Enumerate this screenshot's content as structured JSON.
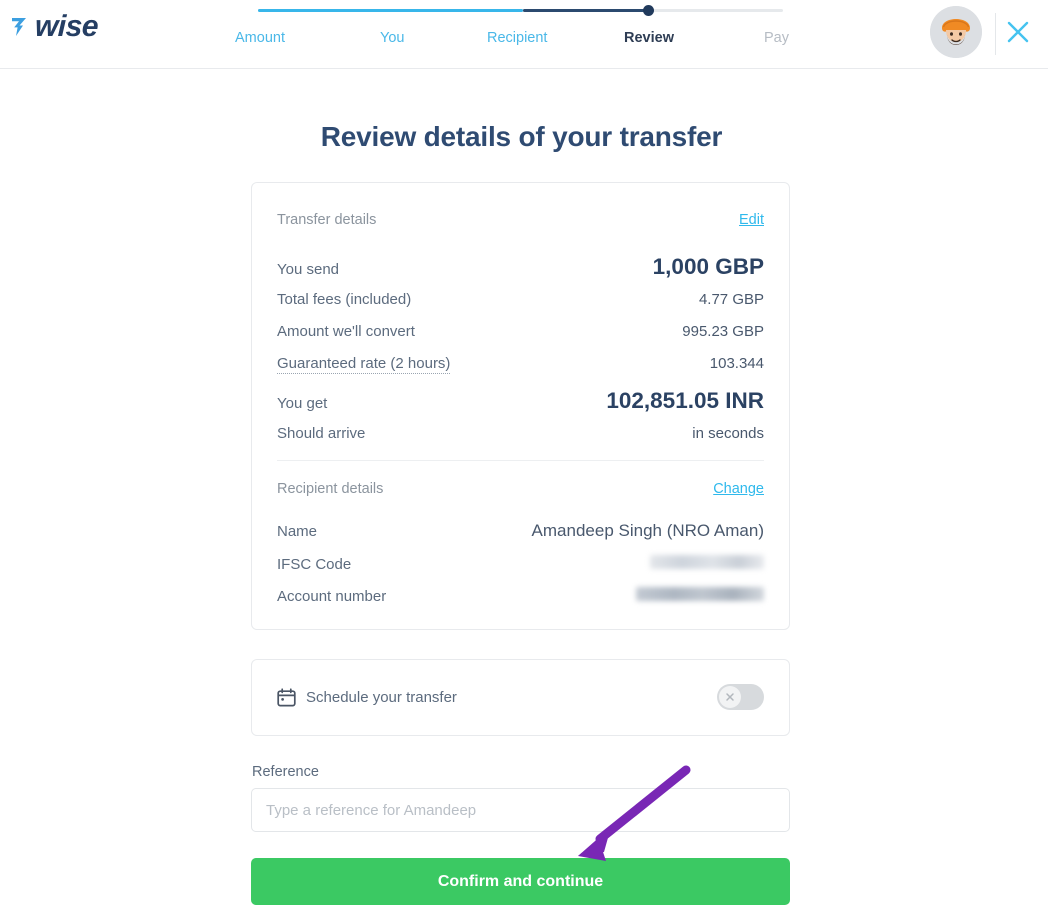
{
  "brand": {
    "name": "wise",
    "logo_mark_color": "#3c9fe0",
    "logo_text_color": "#253e63",
    "accent_blue": "#2fb9ec",
    "accent_green": "#3bc963",
    "annotation_purple": "#7927b5"
  },
  "header": {
    "steps": [
      {
        "label": "Amount",
        "state": "done"
      },
      {
        "label": "You",
        "state": "done"
      },
      {
        "label": "Recipient",
        "state": "done"
      },
      {
        "label": "Review",
        "state": "current"
      },
      {
        "label": "Pay",
        "state": "upcoming"
      }
    ],
    "avatar_alt": "user-avatar",
    "close_label": "×"
  },
  "main": {
    "title": "Review details of your transfer"
  },
  "transfer_details": {
    "section_title": "Transfer details",
    "edit_label": "Edit",
    "rows": [
      {
        "label": "You send",
        "value": "1,000 GBP",
        "emphasis": true
      },
      {
        "label": "Total fees (included)",
        "value": "4.77 GBP",
        "emphasis": false
      },
      {
        "label": "Amount we'll convert",
        "value": "995.23 GBP",
        "emphasis": false
      },
      {
        "label": "Guaranteed rate (2 hours)",
        "value": "103.344",
        "emphasis": false
      },
      {
        "label": "You get",
        "value": "102,851.05 INR",
        "emphasis": true
      },
      {
        "label": "Should arrive",
        "value": "in seconds",
        "emphasis": false
      }
    ]
  },
  "recipient_details": {
    "section_title": "Recipient details",
    "change_label": "Change",
    "rows": [
      {
        "label": "Name",
        "value": "Amandeep Singh (NRO Aman)",
        "redacted": false
      },
      {
        "label": "IFSC Code",
        "value": "",
        "redacted": true
      },
      {
        "label": "Account number",
        "value": "",
        "redacted": true
      }
    ]
  },
  "schedule": {
    "icon": "calendar-icon",
    "label": "Schedule your transfer",
    "toggle_state": "off",
    "toggle_glyph": "×"
  },
  "reference": {
    "label": "Reference",
    "value": "",
    "placeholder": "Type a reference for Amandeep"
  },
  "cta": {
    "label": "Confirm and continue"
  }
}
